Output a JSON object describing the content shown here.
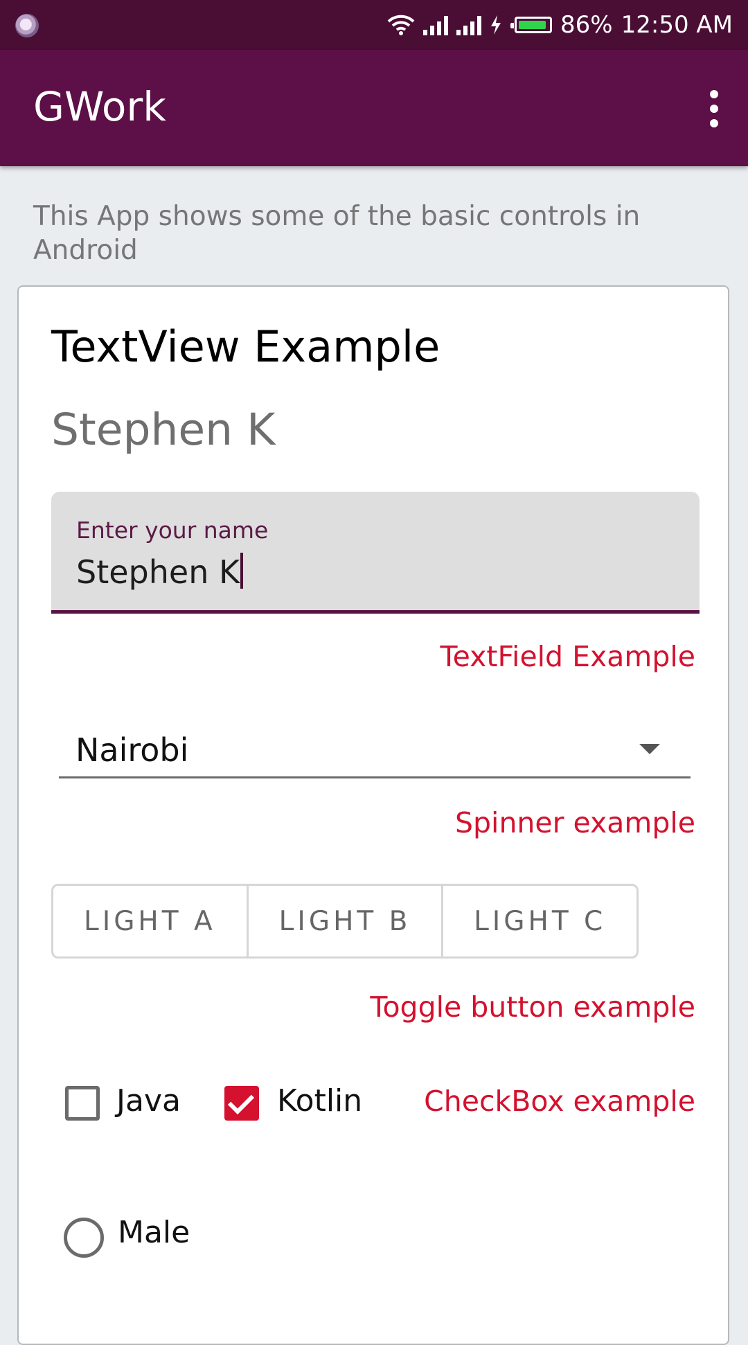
{
  "status_bar": {
    "battery_percent": "86%",
    "time": "12:50 AM",
    "icons": [
      "app-notification-icon",
      "wifi-icon",
      "signal-icon",
      "signal-icon",
      "charging-icon",
      "battery-icon"
    ],
    "battery_color": "#2fd44a"
  },
  "app_bar": {
    "title": "GWork",
    "menu_icon": "more-vert-icon",
    "background": "#5d0f47"
  },
  "intro_text": "This App shows some of the basic controls in Android",
  "card": {
    "textview_heading": "TextView Example",
    "textview_value": "Stephen K",
    "textfield": {
      "label": "Enter your name",
      "value": "Stephen K",
      "caption": "TextField Example"
    },
    "spinner": {
      "selected": "Nairobi",
      "caption": "Spinner example"
    },
    "toggle_group": {
      "buttons": [
        "LIGHT A",
        "LIGHT B",
        "LIGHT C"
      ],
      "caption": "Toggle button example"
    },
    "checkboxes": {
      "items": [
        {
          "label": "Java",
          "checked": false
        },
        {
          "label": "Kotlin",
          "checked": true
        }
      ],
      "caption": "CheckBox example"
    },
    "radio": {
      "label": "Male",
      "selected": false
    }
  },
  "colors": {
    "accent_red": "#d4112f",
    "primary_dark": "#4a0e35",
    "primary": "#5d0f47"
  }
}
